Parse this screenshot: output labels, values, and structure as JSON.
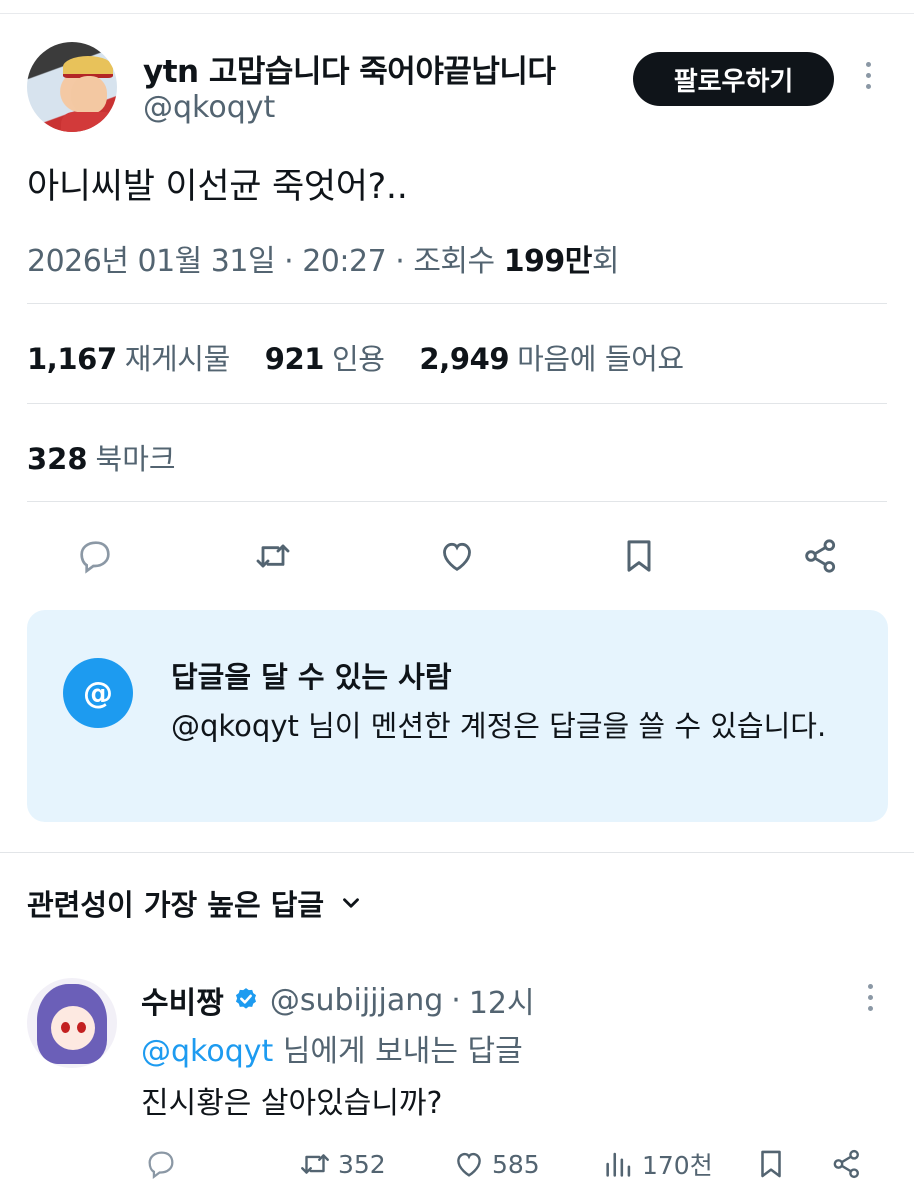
{
  "tweet": {
    "display_name": "ytn 고맙습니다 죽어야끝납니다",
    "handle": "@qkoqyt",
    "follow_label": "팔로우하기",
    "text": "아니씨발 이선균 죽엇어?..",
    "date": "2026년 01월 31일",
    "time": "20:27",
    "views_prefix": "조회수",
    "views_value": "199만",
    "views_suffix": "회",
    "separator": "·"
  },
  "stats": {
    "reposts_count": "1,167",
    "reposts_label": "재게시물",
    "quotes_count": "921",
    "quotes_label": "인용",
    "likes_count": "2,949",
    "likes_label": "마음에 들어요",
    "bookmarks_count": "328",
    "bookmarks_label": "북마크"
  },
  "actions": [
    "reply-icon",
    "repost-icon",
    "like-icon",
    "bookmark-icon",
    "share-icon"
  ],
  "reply_restriction": {
    "icon": "@",
    "title": "답글을 달 수 있는 사람",
    "description": "@qkoqyt 님이 멘션한 계정은 답글을 쓸 수 있습니다."
  },
  "sort": {
    "label": "관련성이 가장 높은 답글"
  },
  "reply": {
    "name": "수비짱",
    "handle": "@subijjjang",
    "separator": "·",
    "time": "12시",
    "replying_to_mention": "@qkoqyt",
    "replying_to_suffix": "님에게 보내는 답글",
    "text": "진시황은 살아있습니까?",
    "reposts": "352",
    "likes": "585",
    "views": "170천"
  },
  "colors": {
    "accent": "#1d9bf0",
    "text": "#0f1419",
    "muted": "#536471",
    "reply_box_bg": "#e6f4fd"
  }
}
